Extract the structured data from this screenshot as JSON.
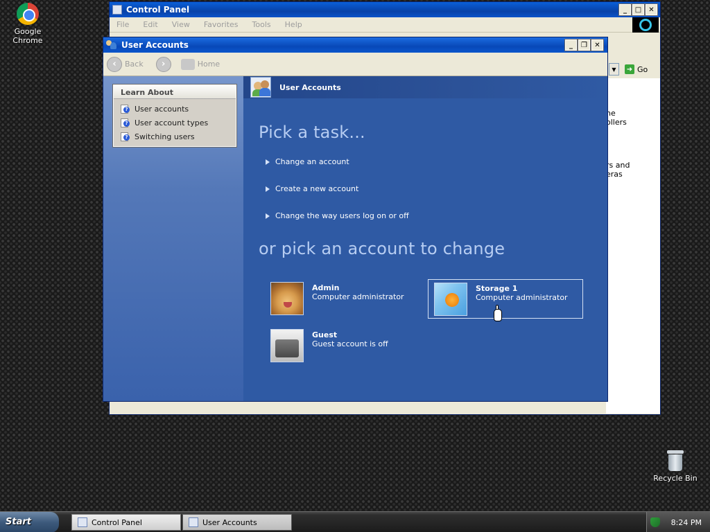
{
  "desktop": {
    "chrome_label": "Google Chrome",
    "recycle_label": "Recycle Bin"
  },
  "control_panel": {
    "title": "Control Panel",
    "menu": [
      "File",
      "Edit",
      "View",
      "Favorites",
      "Tools",
      "Help"
    ],
    "go_label": "Go",
    "fragments": [
      "ne",
      "ollers",
      "rs and",
      "eras"
    ]
  },
  "user_accounts": {
    "title": "User Accounts",
    "nav": {
      "back_label": "Back",
      "home_label": "Home"
    },
    "learn_about": {
      "heading": "Learn About",
      "items": [
        "User accounts",
        "User account types",
        "Switching users"
      ]
    },
    "main_heading": "User Accounts",
    "pick_task_title": "Pick a task...",
    "tasks": [
      "Change an account",
      "Create a new account",
      "Change the way users log on or off"
    ],
    "pick_account_title": "or pick an account to change",
    "accounts": [
      {
        "name": "Admin",
        "role": "Computer administrator",
        "picture": "golden-retriever"
      },
      {
        "name": "Storage 1",
        "role": "Computer administrator",
        "picture": "goldfish"
      },
      {
        "name": "Guest",
        "role": "Guest account is off",
        "picture": "briefcase"
      }
    ]
  },
  "taskbar": {
    "start_label": "Start",
    "buttons": [
      "Control Panel",
      "User Accounts"
    ],
    "clock": "8:24 PM"
  }
}
